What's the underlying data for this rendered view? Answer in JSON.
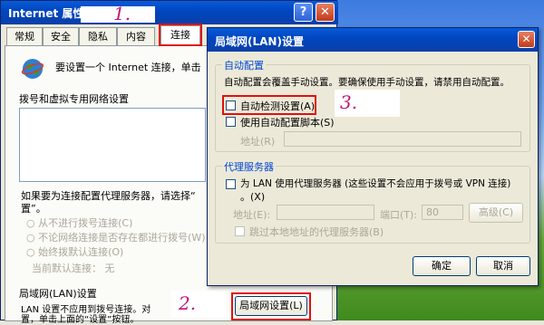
{
  "bg_dialog": {
    "title": "Internet 属性",
    "help_btn": "?",
    "close_btn": "✕",
    "tabs": [
      "常规",
      "安全",
      "隐私",
      "内容",
      "连接"
    ],
    "intro_text_line1": "要设置一个 Internet 连接，单击",
    "dialup_label": "拨号和虚拟专用网络设置",
    "proxy_text_line1": "如果要为连接配置代理服务器，请选择“",
    "proxy_text_line2": "置”。",
    "radio_never": "从不进行拨号连接(C)",
    "radio_whenever": "不论网络连接是否存在都进行拨号(W)",
    "radio_always": "始终拨默认连接(O)",
    "current_default": "当前默认连接：  无",
    "lan_section": "局域网(LAN)设置",
    "lan_text_line1": "LAN 设置不应用到拨号连接。对",
    "lan_text_line2": "置，单击上面的“设置”按钮。",
    "lan_settings_button": "局域网设置(L)"
  },
  "callouts": [
    "1.",
    "2.",
    "3."
  ],
  "lan_dialog": {
    "title": "局域网(LAN)设置",
    "close_btn": "✕",
    "auto_config_group": "自动配置",
    "auto_config_desc": "自动配置会覆盖手动设置。要确保使用手动设置，请禁用自动配置。",
    "auto_detect": "自动检测设置(A)",
    "use_script": "使用自动配置脚本(S)",
    "address_label": "地址(R)",
    "proxy_group": "代理服务器",
    "proxy_check_line1": "为 LAN 使用代理服务器 (这些设置不会应用于拨号或 VPN 连接)",
    "proxy_check_line2": "。(X)",
    "proxy_address_label": "地址(E):",
    "port_label": "端口(T):",
    "port_value": "80",
    "advanced_button": "高级(C)",
    "bypass_local": "跳过本地地址的代理服务器(B)",
    "ok_button": "确定",
    "cancel_button": "取消"
  }
}
